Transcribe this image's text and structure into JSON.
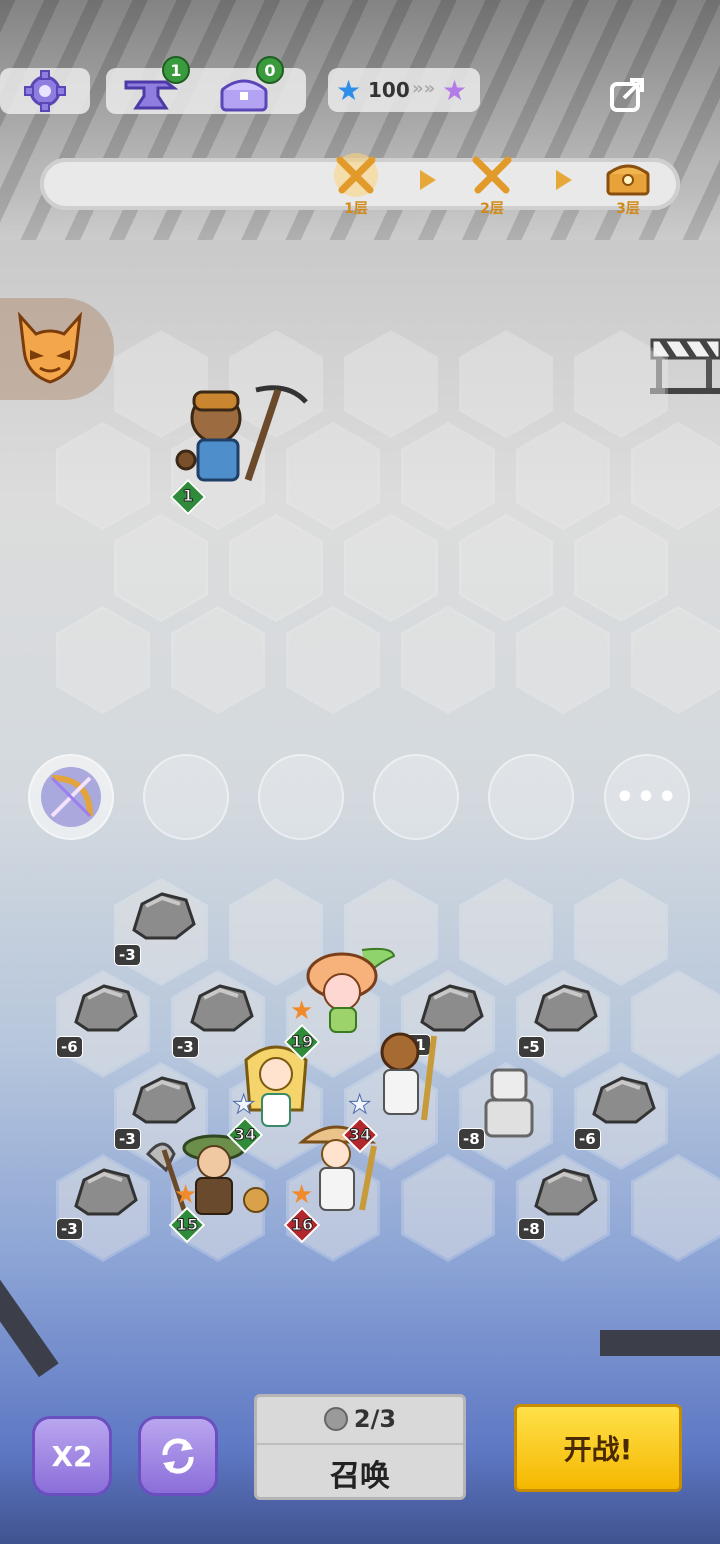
{
  "hud": {
    "settings_icon": "gear-icon",
    "anvil_count": "1",
    "chest_count": "0",
    "star_count": "100",
    "share_icon": "share-icon"
  },
  "progress": {
    "floors": [
      {
        "label": "1层",
        "icon": "crossed-swords-icon",
        "active": true
      },
      {
        "label": "2层",
        "icon": "crossed-swords-icon",
        "active": false
      },
      {
        "label": "3层",
        "icon": "treasure-chest-icon",
        "active": false
      }
    ]
  },
  "enemy": {
    "name_icon": "miner-bear",
    "level": "1"
  },
  "skill_slots": {
    "first_icon": "crossbow-icon",
    "more_label": "•••"
  },
  "rocks": [
    "-3",
    "-6",
    "-3",
    "-1",
    "-5",
    "-3",
    "-8",
    "-6",
    "-3",
    "-8"
  ],
  "heroes": [
    {
      "name": "mushroom-girl",
      "level": "19",
      "star": "orange"
    },
    {
      "name": "blonde-mage",
      "level": "34",
      "star": "white"
    },
    {
      "name": "white-robed-swordsman",
      "level": "34",
      "star": "white"
    },
    {
      "name": "green-hat-warrior",
      "level": "15",
      "star": "orange"
    },
    {
      "name": "straw-hat-monk",
      "level": "16",
      "star": "orange"
    }
  ],
  "buttons": {
    "speed_label": "X2",
    "refresh_icon": "refresh-icon",
    "summon_count": "2/3",
    "summon_label": "召唤",
    "fight_label": "开战!"
  },
  "colors": {
    "accent_gold": "#f5b800",
    "purple_button": "#8b6ed9",
    "level_green": "#2f8a3a",
    "level_red": "#b2272b"
  }
}
